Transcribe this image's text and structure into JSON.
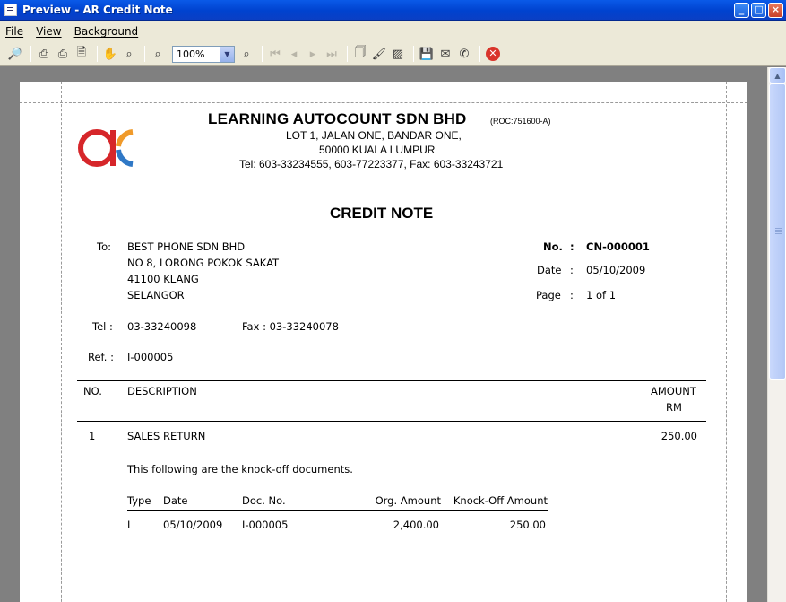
{
  "window": {
    "title": "Preview - AR Credit Note",
    "buttons": {
      "minimize": "_",
      "maximize": "□",
      "close": "×"
    }
  },
  "menu": [
    {
      "key": "F",
      "rest": "ile"
    },
    {
      "key": "V",
      "rest": "iew"
    },
    {
      "key": "B",
      "rest": "ackground"
    }
  ],
  "toolbar": {
    "zoom_value": "100%",
    "icons": [
      "binoculars-icon",
      "print-setup-icon",
      "print-icon",
      "export-icon",
      "hand-icon",
      "magnifier-icon",
      "zoom-out-icon",
      "zoom-in-icon",
      "first-page-icon",
      "prev-page-icon",
      "next-page-icon",
      "last-page-icon",
      "page-setup-icon",
      "paint-icon",
      "watermark-icon",
      "save-icon",
      "email-icon",
      "fax-icon",
      "close-preview-icon"
    ]
  },
  "company": {
    "name": "LEARNING AUTOCOUNT SDN BHD",
    "roc": "(ROC:751600-A)",
    "address1": "LOT 1, JALAN ONE,  BANDAR ONE,",
    "address2": "50000  KUALA LUMPUR",
    "contact": "Tel: 603-33234555,  603-77223377,  Fax: 603-33243721",
    "logo_colors": {
      "red": "#d6262a",
      "orange": "#f09a2a",
      "blue": "#2f78c6"
    }
  },
  "document": {
    "title": "CREDIT NOTE",
    "to_label": "To:",
    "to_lines": [
      "BEST PHONE SDN BHD",
      "NO 8, LORONG POKOK SAKAT",
      "41100 KLANG",
      "SELANGOR"
    ],
    "tel_label": "Tel :",
    "tel": "03-33240098",
    "fax": "Fax : 03-33240078",
    "ref_label": "Ref. :",
    "ref": "I-000005",
    "no_label": "No.",
    "no": "CN-000001",
    "date_label": "Date",
    "date": "05/10/2009",
    "page_label": "Page",
    "page": "1 of 1",
    "colon": ":"
  },
  "table": {
    "headers": {
      "no": "NO.",
      "description": "DESCRIPTION",
      "amount": "AMOUNT",
      "currency": "RM"
    },
    "rows": [
      {
        "no": "1",
        "description": "SALES RETURN",
        "amount": "250.00"
      }
    ]
  },
  "knockoff": {
    "intro": "This following are the knock-off documents.",
    "headers": {
      "type": "Type",
      "date": "Date",
      "doc_no": "Doc. No.",
      "org_amount": "Org. Amount",
      "ko_amount": "Knock-Off Amount"
    },
    "rows": [
      {
        "type": "I",
        "date": "05/10/2009",
        "doc_no": "I-000005",
        "org_amount": "2,400.00",
        "ko_amount": "250.00"
      }
    ]
  }
}
